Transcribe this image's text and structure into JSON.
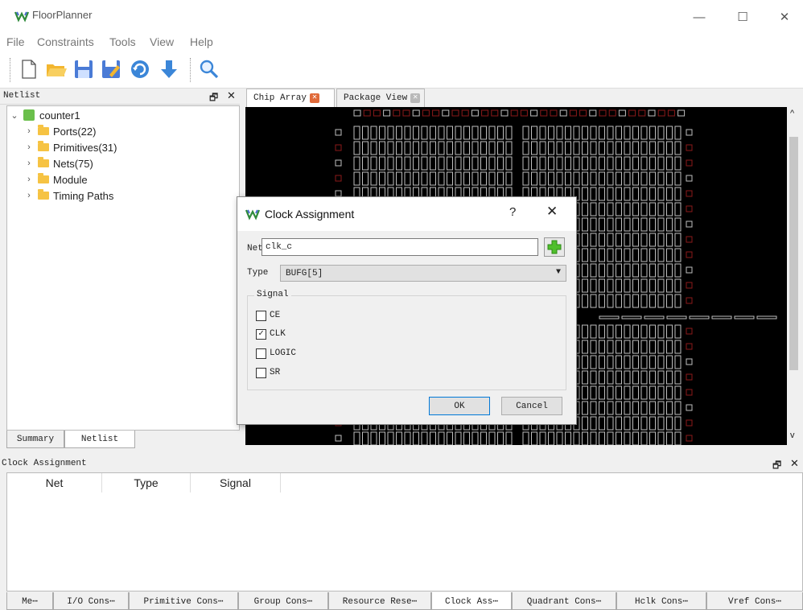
{
  "window": {
    "title": "FloorPlanner",
    "minimize": "—",
    "maximize": "☐",
    "close": "✕"
  },
  "menu": [
    "File",
    "Constraints",
    "Tools",
    "View",
    "Help"
  ],
  "toolbar": [
    "new-file-icon",
    "open-folder-icon",
    "save-icon",
    "save-as-icon",
    "refresh-icon",
    "download-icon",
    "search-icon"
  ],
  "netlist": {
    "title": "Netlist",
    "float_icon": "🗗",
    "close_icon": "✕",
    "root": "counter1",
    "items": [
      "Ports(22)",
      "Primitives(31)",
      "Nets(75)",
      "Module",
      "Timing Paths"
    ],
    "tabs": [
      "Summary",
      "Netlist"
    ]
  },
  "chip": {
    "tabs": [
      "Chip Array",
      "Package View"
    ],
    "scroll_up": "^",
    "scroll_down": "v"
  },
  "clock_panel": {
    "title": "Clock Assignment",
    "float_icon": "🗗",
    "close_icon": "✕",
    "columns": [
      "Net",
      "Type",
      "Signal"
    ]
  },
  "bottom_tabs": [
    "Me⋯",
    "I/O Cons⋯",
    "Primitive Cons⋯",
    "Group Cons⋯",
    "Resource Rese⋯",
    "Clock Ass⋯",
    "Quadrant Cons⋯",
    "Hclk Cons⋯",
    "Vref Cons⋯"
  ],
  "dialog": {
    "title": "Clock Assignment",
    "help": "?",
    "close": "✕",
    "net_label": "Net",
    "net_value": "clk_c",
    "type_label": "Type",
    "type_value": "BUFG[5]",
    "signal_label": "Signal",
    "signals": [
      {
        "label": "CE",
        "checked": false
      },
      {
        "label": "CLK",
        "checked": true
      },
      {
        "label": "LOGIC",
        "checked": false
      },
      {
        "label": "SR",
        "checked": false
      }
    ],
    "ok": "OK",
    "cancel": "Cancel"
  },
  "colors": {
    "chip_bg": "#000000",
    "cell_stroke": "#bfbfbf",
    "pad_red": "#8b1a1a",
    "accent": "#0078d7"
  }
}
